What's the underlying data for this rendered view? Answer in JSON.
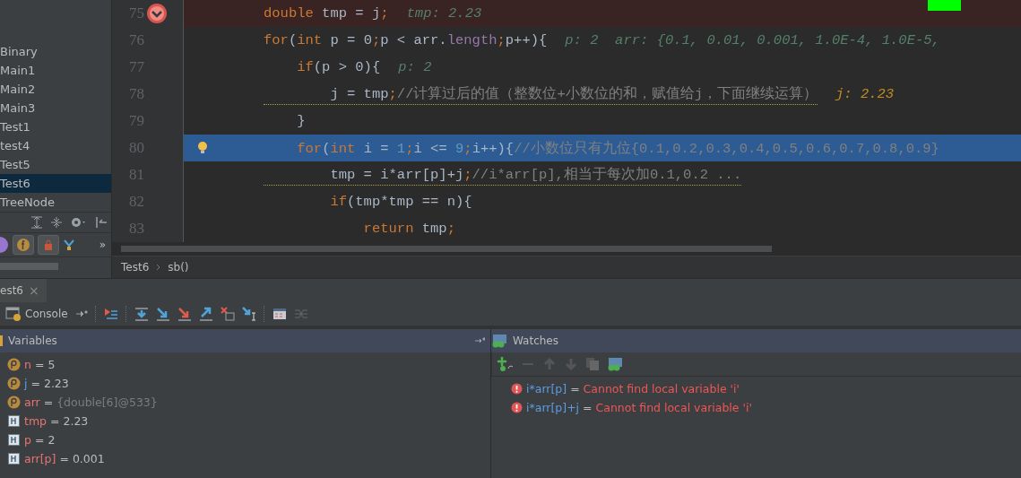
{
  "project_tree": {
    "items": [
      {
        "label": "Binary",
        "selected": false
      },
      {
        "label": "Main1",
        "selected": false
      },
      {
        "label": "Main2",
        "selected": false
      },
      {
        "label": "Main3",
        "selected": false
      },
      {
        "label": "Test1",
        "selected": false
      },
      {
        "label": "test4",
        "selected": false
      },
      {
        "label": "Test5",
        "selected": false
      },
      {
        "label": "Test6",
        "selected": true
      },
      {
        "label": "TreeNode",
        "selected": false
      }
    ],
    "toolbar_more": "»"
  },
  "editor": {
    "lines": [
      {
        "number": "75",
        "kind": "breakpoint",
        "underlined": false,
        "code": [
          {
            "text": "double",
            "kind": "keyword"
          },
          {
            "text": " tmp = j",
            "kind": "plain"
          },
          {
            "text": ";",
            "kind": "keyword"
          }
        ],
        "inline_values": [
          {
            "text": "tmp: 2.23",
            "changed": false
          }
        ]
      },
      {
        "number": "76",
        "kind": "normal",
        "underlined": false,
        "code": [
          {
            "text": "for",
            "kind": "keyword"
          },
          {
            "text": "(",
            "kind": "plain"
          },
          {
            "text": "int",
            "kind": "keyword"
          },
          {
            "text": " p = 0",
            "kind": "plain"
          },
          {
            "text": ";",
            "kind": "keyword"
          },
          {
            "text": "p < arr.",
            "kind": "plain"
          },
          {
            "text": "length",
            "kind": "field"
          },
          {
            "text": ";",
            "kind": "keyword"
          },
          {
            "text": "p++){",
            "kind": "plain"
          }
        ],
        "inline_values": [
          {
            "text": "p: 2  arr: {0.1, 0.01, 0.001, 1.0E-4, 1.0E-5,",
            "changed": false
          }
        ]
      },
      {
        "number": "77",
        "kind": "normal",
        "underlined": false,
        "code": [
          {
            "text": "    if",
            "kind": "keyword"
          },
          {
            "text": "(p > 0){",
            "kind": "plain"
          }
        ],
        "inline_values": [
          {
            "text": "p: 2",
            "changed": false
          }
        ]
      },
      {
        "number": "78",
        "kind": "normal",
        "underlined": true,
        "code": [
          {
            "text": "        j = tmp",
            "kind": "plain"
          },
          {
            "text": ";",
            "kind": "keyword"
          },
          {
            "text": "//计算过后的值（整数位+小数位的和，赋值给j，下面继续运算）",
            "kind": "comment"
          }
        ],
        "inline_values": [
          {
            "text": "j: 2.23",
            "changed": true
          }
        ]
      },
      {
        "number": "79",
        "kind": "normal",
        "underlined": false,
        "code": [
          {
            "text": "    }",
            "kind": "plain"
          }
        ]
      },
      {
        "number": "80",
        "kind": "current",
        "underlined": false,
        "code": [
          {
            "text": "    for",
            "kind": "keyword"
          },
          {
            "text": "(",
            "kind": "plain"
          },
          {
            "text": "int",
            "kind": "keyword"
          },
          {
            "text": " i = ",
            "kind": "plain"
          },
          {
            "text": "1",
            "kind": "number"
          },
          {
            "text": ";",
            "kind": "keyword"
          },
          {
            "text": "i <= ",
            "kind": "plain"
          },
          {
            "text": "9",
            "kind": "number"
          },
          {
            "text": ";",
            "kind": "keyword"
          },
          {
            "text": "i++){",
            "kind": "plain"
          },
          {
            "text": "//小数位只有九位{0.1,0.2,0.3,0.4,0.5,0.6,0.7,0.8,0.9}",
            "kind": "comment"
          }
        ]
      },
      {
        "number": "81",
        "kind": "normal",
        "underlined": true,
        "code": [
          {
            "text": "        tmp = i*arr[p]+j",
            "kind": "plain"
          },
          {
            "text": ";",
            "kind": "keyword"
          },
          {
            "text": "//i*arr[p],相当于每次加0.1,0.2 ...",
            "kind": "comment"
          }
        ]
      },
      {
        "number": "82",
        "kind": "normal",
        "underlined": false,
        "code": [
          {
            "text": "        if",
            "kind": "keyword"
          },
          {
            "text": "(tmp*tmp == n){",
            "kind": "plain"
          }
        ]
      },
      {
        "number": "83",
        "kind": "normal",
        "underlined": false,
        "code": [
          {
            "text": "            return",
            "kind": "keyword"
          },
          {
            "text": " tmp",
            "kind": "plain"
          },
          {
            "text": ";",
            "kind": "keyword"
          }
        ]
      }
    ],
    "breadcrumbs": [
      {
        "label": "Test6"
      },
      {
        "label": "sb()"
      }
    ]
  },
  "debug": {
    "tab": {
      "label": "est6",
      "close": "×"
    },
    "console_label": "Console",
    "variables": {
      "title": "Variables",
      "items": [
        {
          "kind": "param",
          "name": "n",
          "operator": "=",
          "value": "5",
          "highlighted": false,
          "reference": false
        },
        {
          "kind": "param",
          "name": "j",
          "operator": "=",
          "value": "2.23",
          "highlighted": true,
          "reference": false
        },
        {
          "kind": "param",
          "name": "arr",
          "operator": "=",
          "value": "{double[6]@533}",
          "highlighted": false,
          "reference": true
        },
        {
          "kind": "local",
          "name": "tmp",
          "operator": "=",
          "value": "2.23",
          "highlighted": false,
          "reference": false
        },
        {
          "kind": "local",
          "name": "p",
          "operator": "=",
          "value": "2",
          "highlighted": false,
          "reference": false
        },
        {
          "kind": "local",
          "name": "arr[p]",
          "operator": "=",
          "value": "0.001",
          "highlighted": false,
          "reference": false
        }
      ]
    },
    "watches": {
      "title": "Watches",
      "items": [
        {
          "expression": "i*arr[p]",
          "operator": "=",
          "message": "Cannot find local variable 'i'"
        },
        {
          "expression": "i*arr[p]+j",
          "operator": "=",
          "message": "Cannot find local variable 'i'"
        }
      ]
    }
  }
}
